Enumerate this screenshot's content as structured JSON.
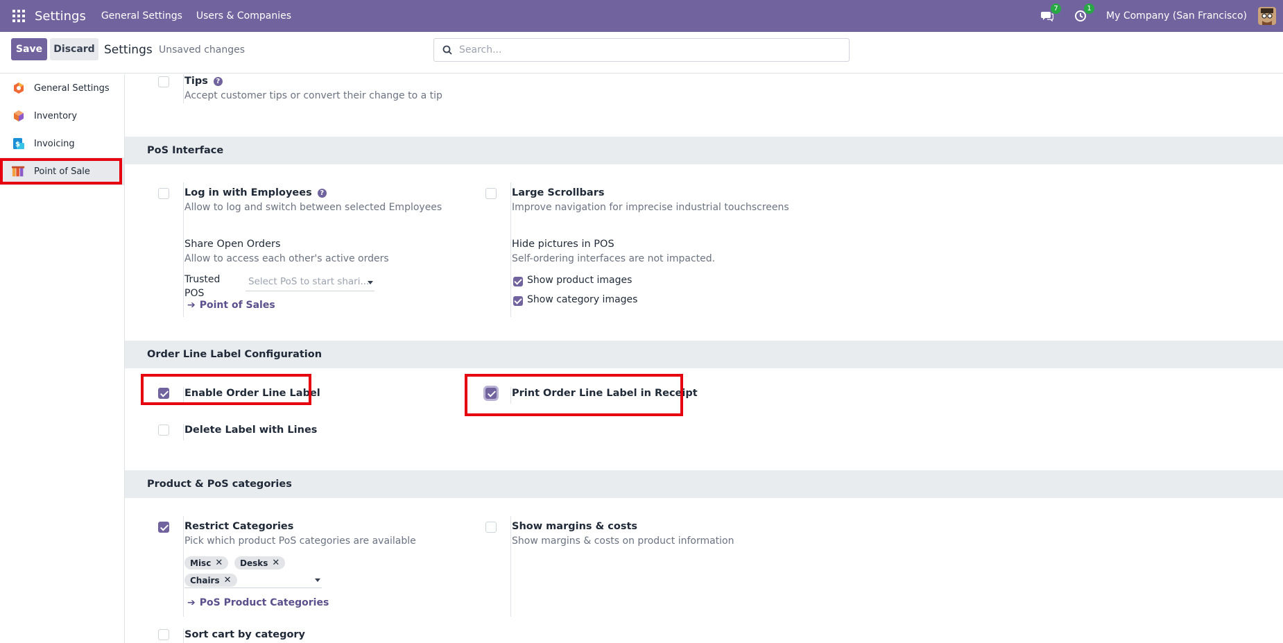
{
  "navbar": {
    "app_title": "Settings",
    "menus": [
      "General Settings",
      "Users & Companies"
    ],
    "messages_badge": "7",
    "activities_badge": "1",
    "company": "My Company (San Francisco)"
  },
  "control_panel": {
    "save_label": "Save",
    "discard_label": "Discard",
    "title": "Settings",
    "status": "Unsaved changes",
    "search_placeholder": "Search..."
  },
  "sidebar": {
    "items": [
      {
        "label": "General Settings",
        "icon": "general-settings-icon"
      },
      {
        "label": "Inventory",
        "icon": "inventory-icon"
      },
      {
        "label": "Invoicing",
        "icon": "invoicing-icon"
      },
      {
        "label": "Point of Sale",
        "icon": "point-of-sale-icon",
        "active": true
      }
    ]
  },
  "tips": {
    "title": "Tips",
    "desc": "Accept customer tips or convert their change to a tip",
    "checked": false
  },
  "pos_interface": {
    "heading": "PoS Interface",
    "login_employees": {
      "title": "Log in with Employees",
      "desc": "Allow to log and switch between selected Employees",
      "checked": false
    },
    "large_scrollbars": {
      "title": "Large Scrollbars",
      "desc": "Improve navigation for imprecise industrial touchscreens",
      "checked": false
    },
    "share_orders": {
      "title": "Share Open Orders",
      "desc": "Allow to access each other's active orders",
      "trusted_label_1": "Trusted",
      "trusted_label_2": "POS",
      "select_placeholder": "Select PoS to start shari...",
      "link": "Point of Sales"
    },
    "hide_pictures": {
      "title": "Hide pictures in POS",
      "desc": "Self-ordering interfaces are not impacted.",
      "show_product_images": "Show product images",
      "show_category_images": "Show category images"
    }
  },
  "order_line": {
    "heading": "Order Line Label Configuration",
    "enable_label": {
      "title": "Enable Order Line Label",
      "checked": true
    },
    "print_label": {
      "title": "Print Order Line Label in Receipt",
      "checked": true
    },
    "delete_label": {
      "title": "Delete Label with Lines",
      "checked": false
    }
  },
  "product_categories": {
    "heading": "Product & PoS categories",
    "restrict": {
      "title": "Restrict Categories",
      "desc": "Pick which product PoS categories are available",
      "checked": true,
      "tags": [
        "Misc",
        "Desks",
        "Chairs"
      ],
      "link": "PoS Product Categories"
    },
    "margins": {
      "title": "Show margins & costs",
      "desc": "Show margins & costs on product information",
      "checked": false
    },
    "sort_cart": {
      "title": "Sort cart by category",
      "checked": false
    }
  },
  "colors": {
    "brand": "#71639e",
    "highlight": "#e6000f",
    "section_bg": "#e9ecef"
  }
}
